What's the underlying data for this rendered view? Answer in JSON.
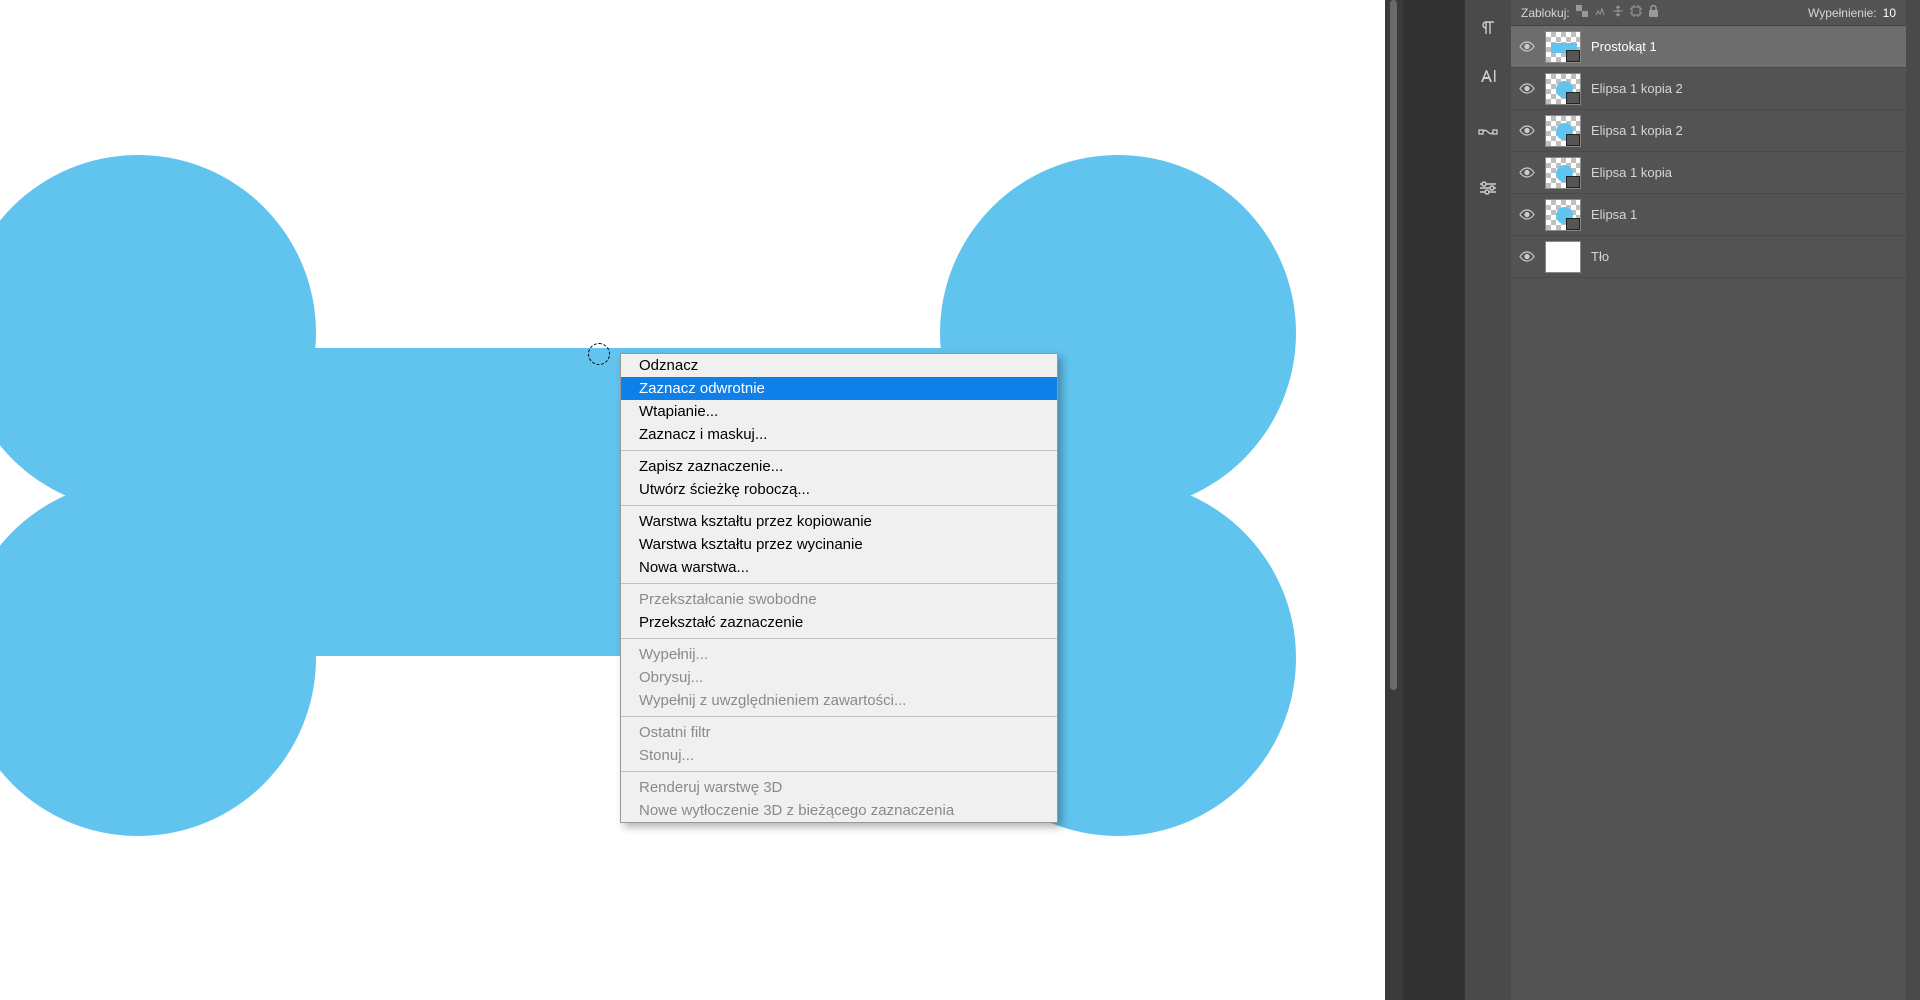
{
  "contextMenu": {
    "items": [
      {
        "label": "Odznacz",
        "enabled": true,
        "highlighted": false
      },
      {
        "label": "Zaznacz odwrotnie",
        "enabled": true,
        "highlighted": true
      },
      {
        "label": "Wtapianie...",
        "enabled": true,
        "highlighted": false
      },
      {
        "label": "Zaznacz i maskuj...",
        "enabled": true,
        "highlighted": false
      },
      {
        "sep": true
      },
      {
        "label": "Zapisz zaznaczenie...",
        "enabled": true,
        "highlighted": false
      },
      {
        "label": "Utwórz ścieżkę roboczą...",
        "enabled": true,
        "highlighted": false
      },
      {
        "sep": true
      },
      {
        "label": "Warstwa kształtu przez kopiowanie",
        "enabled": true,
        "highlighted": false
      },
      {
        "label": "Warstwa kształtu przez wycinanie",
        "enabled": true,
        "highlighted": false
      },
      {
        "label": "Nowa warstwa...",
        "enabled": true,
        "highlighted": false
      },
      {
        "sep": true
      },
      {
        "label": "Przekształcanie swobodne",
        "enabled": false,
        "highlighted": false
      },
      {
        "label": "Przekształć zaznaczenie",
        "enabled": true,
        "highlighted": false
      },
      {
        "sep": true
      },
      {
        "label": "Wypełnij...",
        "enabled": false,
        "highlighted": false
      },
      {
        "label": "Obrysuj...",
        "enabled": false,
        "highlighted": false
      },
      {
        "label": "Wypełnij z uwzględnieniem zawartości...",
        "enabled": false,
        "highlighted": false
      },
      {
        "sep": true
      },
      {
        "label": "Ostatni filtr",
        "enabled": false,
        "highlighted": false
      },
      {
        "label": "Stonuj...",
        "enabled": false,
        "highlighted": false
      },
      {
        "sep": true
      },
      {
        "label": "Renderuj warstwę 3D",
        "enabled": false,
        "highlighted": false
      },
      {
        "label": "Nowe wytłoczenie 3D z bieżącego zaznaczenia",
        "enabled": false,
        "highlighted": false
      }
    ]
  },
  "layersHeader": {
    "lockLabel": "Zablokuj:",
    "fillLabel": "Wypełnienie:",
    "fillValue": "10"
  },
  "layers": [
    {
      "name": "Prostokąt 1",
      "selected": true,
      "thumb": "rect"
    },
    {
      "name": "Elipsa 1 kopia 2",
      "selected": false,
      "thumb": "ellipse"
    },
    {
      "name": "Elipsa 1 kopia 2",
      "selected": false,
      "thumb": "ellipse"
    },
    {
      "name": "Elipsa 1 kopia",
      "selected": false,
      "thumb": "ellipse"
    },
    {
      "name": "Elipsa 1",
      "selected": false,
      "thumb": "ellipse"
    },
    {
      "name": "Tło",
      "selected": false,
      "thumb": "white"
    }
  ]
}
